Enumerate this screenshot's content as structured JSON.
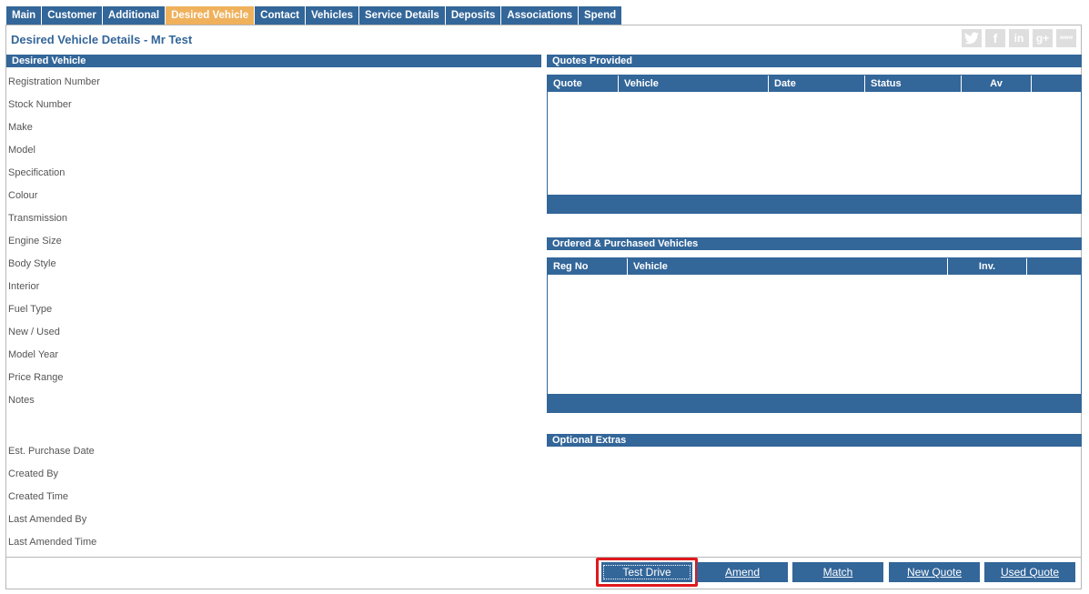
{
  "tabs": [
    "Main",
    "Customer",
    "Additional",
    "Desired Vehicle",
    "Contact",
    "Vehicles",
    "Service Details",
    "Deposits",
    "Associations",
    "Spend"
  ],
  "active_tab": "Desired Vehicle",
  "page_title": "Desired Vehicle Details - Mr Test",
  "social": {
    "twitter": "twitter-icon",
    "facebook": "facebook-icon",
    "linkedin": "linkedin-icon",
    "googleplus": "googleplus-icon",
    "www": "www"
  },
  "desired_vehicle": {
    "header": "Desired Vehicle",
    "fields": [
      "Registration Number",
      "Stock Number",
      "Make",
      "Model",
      "Specification",
      "Colour",
      "Transmission",
      "Engine Size",
      "Body Style",
      "Interior",
      "Fuel Type",
      "New / Used",
      "Model Year",
      "Price Range",
      "Notes"
    ],
    "meta_fields": [
      "Est. Purchase Date",
      "Created By",
      "Created Time",
      "Last Amended By",
      "Last Amended Time"
    ]
  },
  "quotes": {
    "header": "Quotes Provided",
    "columns": [
      "Quote",
      "Vehicle",
      "Date",
      "Status",
      "Av",
      ""
    ]
  },
  "ordered": {
    "header": "Ordered & Purchased Vehicles",
    "columns": [
      "Reg No",
      "Vehicle",
      "Inv.",
      ""
    ]
  },
  "extras": {
    "header": "Optional Extras"
  },
  "buttons": {
    "test_drive": "Test Drive",
    "amend": "Amend",
    "match": "Match",
    "new_quote": "New Quote",
    "used_quote": "Used Quote"
  },
  "colors": {
    "primary": "#336699",
    "active_tab": "#f0b15c",
    "highlight": "#e0191c"
  }
}
